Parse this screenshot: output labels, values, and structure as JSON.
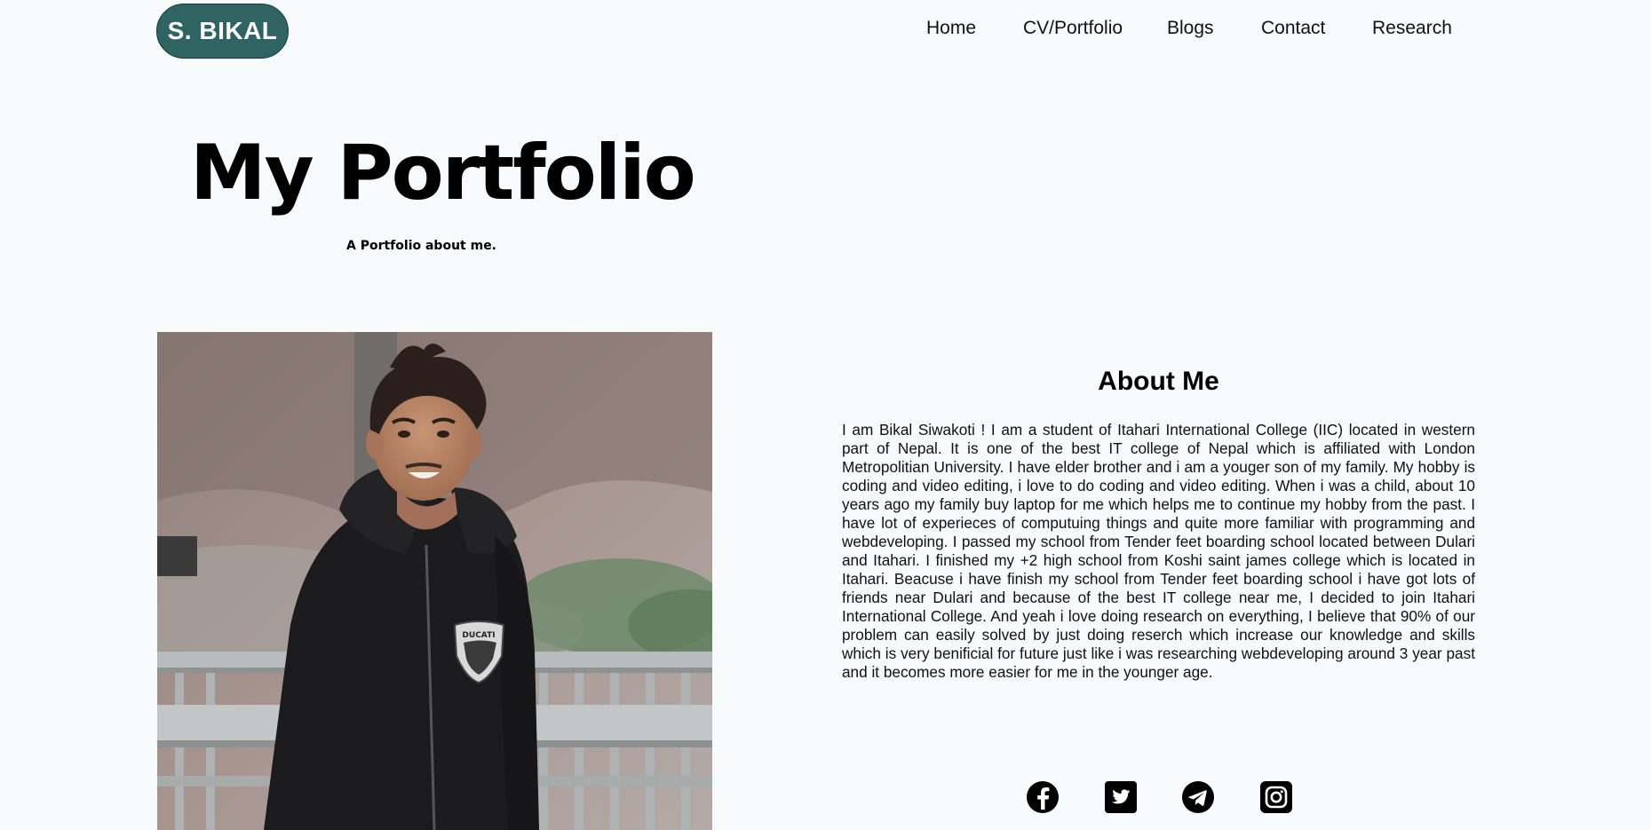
{
  "header": {
    "logo_text": "S. BIKAL",
    "nav": [
      {
        "label": "Home"
      },
      {
        "label": "CV/Portfolio"
      },
      {
        "label": "Blogs"
      },
      {
        "label": "Contact"
      },
      {
        "label": "Research"
      }
    ]
  },
  "hero": {
    "title": "My Portfolio",
    "subtitle": "A Portfolio about me."
  },
  "about": {
    "heading": "About Me",
    "text": "I am Bikal Siwakoti ! I am a student of Itahari International College (IIC) located in western part of Nepal. It is one of the best IT college of Nepal which is affiliated with London Metropolitian University. I have elder brother and i am a youger son of my family. My hobby is coding and video editing, i love to do coding and video editing. When i was a child, about 10 years ago my family buy laptop for me which helps me to continue my hobby from the past. I have lot of experieces of computuing things and quite more familiar with programming and webdeveloping. I passed my school from Tender feet boarding school located between Dulari and Itahari. I finished my +2 high school from Koshi saint james college which is located in Itahari. Beacuse i have finish my school from Tender feet boarding school i have got lots of friends near Dulari and because of the best IT college near me, I decided to join Itahari International College. And yeah i love doing research on everything, I believe that 90% of our problem can easily solved by just doing reserch which increase our knowledge and skills which is very benificial for future just like i was researching webdeveloping around 3 year past and it becomes more easier for me in the younger age."
  },
  "photo": {
    "jacket_logo_text": "DUCATI"
  },
  "social": [
    {
      "icon": "facebook-icon"
    },
    {
      "icon": "twitter-icon"
    },
    {
      "icon": "telegram-icon"
    },
    {
      "icon": "instagram-icon"
    }
  ],
  "colors": {
    "background": "#f7fbfb",
    "logo_bg": "#2f6462",
    "logo_text": "#ffffff",
    "text": "#111111"
  }
}
